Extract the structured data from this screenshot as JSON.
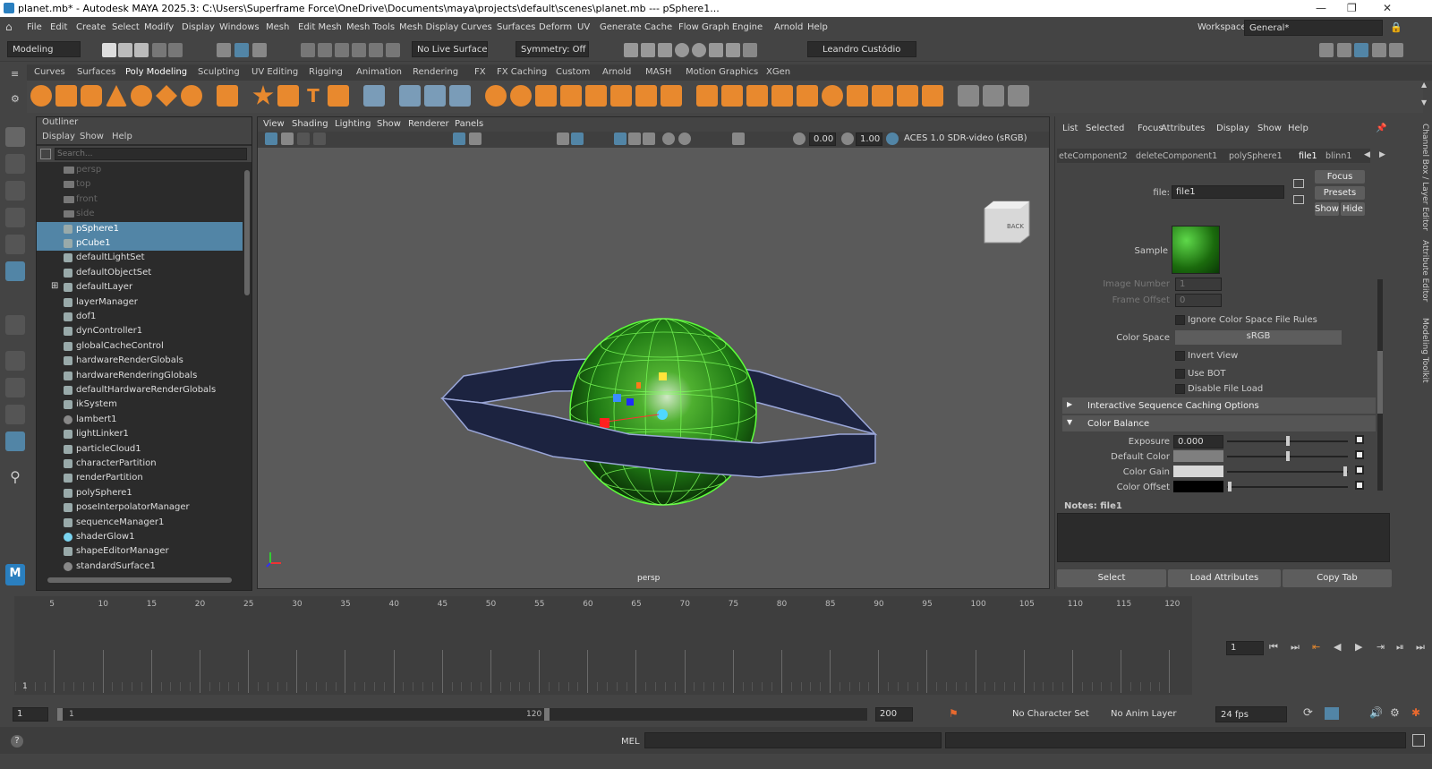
{
  "window": {
    "title": "planet.mb* - Autodesk MAYA 2025.3: C:\\Users\\Superframe Force\\OneDrive\\Documents\\maya\\projects\\default\\scenes\\planet.mb   ---   pSphere1...",
    "minimize": "—",
    "restore": "❐",
    "close": "✕"
  },
  "menubar": {
    "items": [
      "File",
      "Edit",
      "Create",
      "Select",
      "Modify",
      "Display",
      "Windows",
      "Mesh",
      "Edit Mesh",
      "Mesh Tools",
      "Mesh Display",
      "Curves",
      "Surfaces",
      "Deform",
      "UV",
      "Generate",
      "Cache",
      "Flow Graph Engine",
      "Arnold",
      "Help"
    ],
    "workspace_label": "Workspace:",
    "workspace_value": "General*"
  },
  "statusline": {
    "menuset": "Modeling",
    "live_surface": "No Live Surface",
    "symmetry": "Symmetry: Off",
    "user": "Leandro Custódio"
  },
  "shelf": {
    "tabs": [
      "Curves",
      "Surfaces",
      "Poly Modeling",
      "Sculpting",
      "UV Editing",
      "Rigging",
      "Animation",
      "Rendering",
      "FX",
      "FX Caching",
      "Custom",
      "Arnold",
      "MASH",
      "Motion Graphics",
      "XGen"
    ]
  },
  "outliner": {
    "title": "Outliner",
    "menus": [
      "Display",
      "Show",
      "Help"
    ],
    "search_placeholder": "Search...",
    "items": [
      {
        "label": "persp",
        "dim": true
      },
      {
        "label": "top",
        "dim": true
      },
      {
        "label": "front",
        "dim": true
      },
      {
        "label": "side",
        "dim": true
      },
      {
        "label": "pSphere1",
        "selected": true
      },
      {
        "label": "pCube1",
        "selected": true
      },
      {
        "label": "defaultLightSet"
      },
      {
        "label": "defaultObjectSet"
      },
      {
        "label": "defaultLayer",
        "expand": "⊞"
      },
      {
        "label": "layerManager"
      },
      {
        "label": "dof1"
      },
      {
        "label": "dynController1"
      },
      {
        "label": "globalCacheControl"
      },
      {
        "label": "hardwareRenderGlobals"
      },
      {
        "label": "hardwareRenderingGlobals"
      },
      {
        "label": "defaultHardwareRenderGlobals"
      },
      {
        "label": "ikSystem"
      },
      {
        "label": "lambert1"
      },
      {
        "label": "lightLinker1"
      },
      {
        "label": "particleCloud1"
      },
      {
        "label": "characterPartition"
      },
      {
        "label": "renderPartition"
      },
      {
        "label": "polySphere1"
      },
      {
        "label": "poseInterpolatorManager"
      },
      {
        "label": "sequenceManager1"
      },
      {
        "label": "shaderGlow1"
      },
      {
        "label": "shapeEditorManager"
      },
      {
        "label": "standardSurface1"
      }
    ]
  },
  "viewport": {
    "menus": [
      "View",
      "Shading",
      "Lighting",
      "Show",
      "Renderer",
      "Panels"
    ],
    "near": "0.00",
    "far": "1.00",
    "colorspace": "ACES 1.0 SDR-video (sRGB)",
    "camera": "persp",
    "viewcube": "BACK"
  },
  "attribute_editor": {
    "menus": [
      "List",
      "Selected",
      "Focus",
      "Attributes",
      "Display",
      "Show",
      "Help"
    ],
    "tabs": [
      "eteComponent2",
      "deleteComponent1",
      "polySphere1",
      "file1",
      "blinn1"
    ],
    "file_label": "file:",
    "file_value": "file1",
    "buttons": {
      "focus": "Focus",
      "presets": "Presets",
      "show": "Show",
      "hide": "Hide"
    },
    "sample_label": "Sample",
    "image_number_label": "Image Number",
    "image_number": "1",
    "frame_offset_label": "Frame Offset",
    "frame_offset": "0",
    "ignore_cs": "Ignore Color Space File Rules",
    "colorspace_label": "Color Space",
    "colorspace_value": "sRGB",
    "invert_view": "Invert View",
    "use_bot": "Use BOT",
    "disable_file_load": "Disable File Load",
    "section_isc": "Interactive Sequence Caching Options",
    "section_cb": "Color Balance",
    "exposure_label": "Exposure",
    "exposure": "0.000",
    "default_color_label": "Default Color",
    "color_gain_label": "Color Gain",
    "color_offset_label": "Color Offset",
    "notes": "Notes:  file1",
    "bottom_buttons": [
      "Select",
      "Load Attributes",
      "Copy Tab"
    ],
    "side_tabs": [
      "Channel Box / Layer Editor",
      "Attribute Editor",
      "Modeling Toolkit"
    ]
  },
  "timeline": {
    "ticks": [
      "5",
      "10",
      "15",
      "20",
      "25",
      "30",
      "35",
      "40",
      "45",
      "50",
      "55",
      "60",
      "65",
      "70",
      "75",
      "80",
      "85",
      "90",
      "95",
      "100",
      "105",
      "110",
      "115",
      "120"
    ],
    "current_marker": "1",
    "current_frame": "1"
  },
  "range": {
    "start": "1",
    "inner_start": "1",
    "inner_end": "120",
    "end": "200",
    "character_set": "No Character Set",
    "anim_layer": "No Anim Layer",
    "fps": "24 fps"
  },
  "command": {
    "lang": "MEL",
    "help": "?"
  }
}
